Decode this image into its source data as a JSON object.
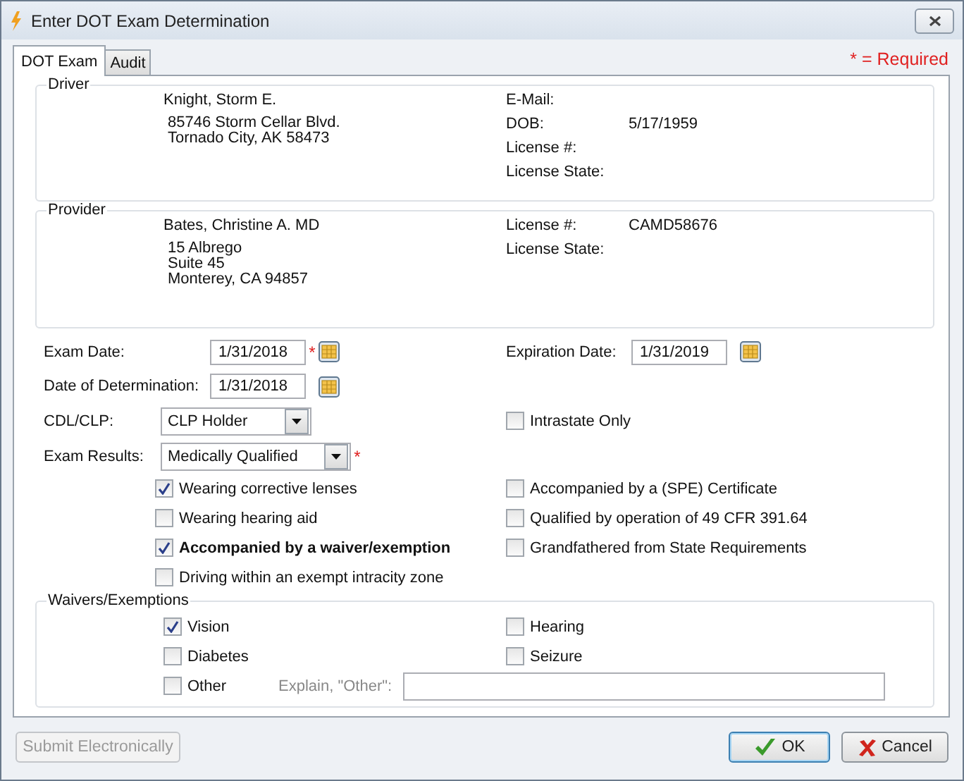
{
  "window": {
    "title": "Enter DOT Exam Determination"
  },
  "tabs": [
    {
      "label": "DOT Exam",
      "selected": true
    },
    {
      "label": "Audit",
      "selected": false
    }
  ],
  "required_note": "* = Required",
  "driver": {
    "title": "Driver",
    "name": "Knight, Storm E.",
    "address_lines": [
      "85746 Storm Cellar Blvd.",
      "Tornado City, AK 58473"
    ],
    "fields": [
      {
        "label": "E-Mail:"
      },
      {
        "label": "DOB:",
        "value": "5/17/1959"
      },
      {
        "label": "License #:"
      },
      {
        "label": "License State:"
      }
    ]
  },
  "provider": {
    "title": "Provider",
    "name": "Bates, Christine A. MD",
    "address_lines": [
      "15 Albrego",
      "Suite 45",
      "Monterey, CA 94857"
    ],
    "fields": [
      {
        "label": "License #:",
        "value": "CAMD58676"
      },
      {
        "label": "License State:"
      }
    ]
  },
  "exam_date": {
    "label": "Exam Date:",
    "value": "1/31/2018",
    "required_mark": "*"
  },
  "expiration_date": {
    "label": "Expiration  Date:",
    "value": "1/31/2019"
  },
  "determination_date": {
    "label": "Date of Determination:",
    "value": "1/31/2018"
  },
  "cdl_clp": {
    "label": "CDL/CLP:",
    "value": "CLP Holder"
  },
  "intrastate_only": {
    "label": "Intrastate Only",
    "checked": false
  },
  "exam_results": {
    "label": "Exam Results:",
    "value": "Medically Qualified",
    "required_mark": "*"
  },
  "options_left": [
    {
      "label": "Wearing corrective lenses",
      "checked": true,
      "bold": false
    },
    {
      "label": "Wearing hearing aid",
      "checked": false,
      "bold": false
    },
    {
      "label": "Accompanied by a waiver/exemption",
      "checked": true,
      "bold": true
    },
    {
      "label": "Driving within an exempt intracity zone",
      "checked": false,
      "bold": false
    }
  ],
  "options_right": [
    {
      "label": "Accompanied by a (SPE) Certificate",
      "checked": false
    },
    {
      "label": "Qualified by operation of 49 CFR 391.64",
      "checked": false
    },
    {
      "label": "Grandfathered from State Requirements",
      "checked": false
    }
  ],
  "waivers": {
    "title": "Waivers/Exemptions",
    "items": [
      {
        "label": "Vision",
        "checked": true
      },
      {
        "label": "Hearing",
        "checked": false
      },
      {
        "label": "Diabetes",
        "checked": false
      },
      {
        "label": "Seizure",
        "checked": false
      },
      {
        "label": "Other",
        "checked": false
      }
    ],
    "explain": {
      "label": "Explain, \"Other\":",
      "disabled": true
    }
  },
  "buttons": [
    {
      "kind": "plain",
      "label": "Submit Electronically",
      "disabled": true
    },
    {
      "kind": "ok",
      "label": "OK",
      "disabled": false
    },
    {
      "kind": "cancel",
      "label": "Cancel",
      "disabled": false
    }
  ]
}
